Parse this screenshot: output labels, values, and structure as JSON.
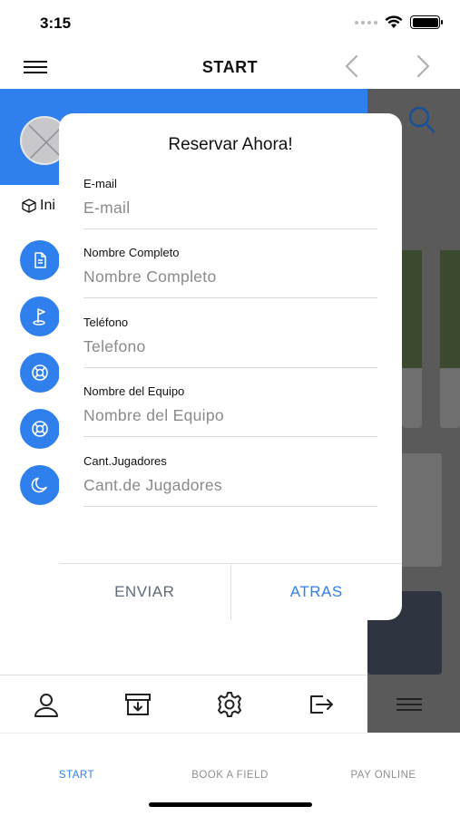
{
  "status_bar": {
    "time": "3:15"
  },
  "nav": {
    "title": "START"
  },
  "drawer": {
    "home_label": "Ini",
    "items": [
      {
        "icon": "document-icon"
      },
      {
        "icon": "golf-flag-icon"
      },
      {
        "icon": "lifebuoy-icon"
      },
      {
        "icon": "lifebuoy-icon"
      },
      {
        "icon": "moon-icon"
      }
    ],
    "footer": [
      "user-icon",
      "archive-download-icon",
      "gear-icon",
      "logout-icon"
    ]
  },
  "modal": {
    "title": "Reservar Ahora!",
    "fields": [
      {
        "label": "E-mail",
        "placeholder": "E-mail"
      },
      {
        "label": "Nombre Completo",
        "placeholder": "Nombre Completo"
      },
      {
        "label": "Teléfono",
        "placeholder": "Telefono"
      },
      {
        "label": "Nombre del Equipo",
        "placeholder": "Nombre del Equipo"
      },
      {
        "label": "Cant.Jugadores",
        "placeholder": "Cant.de Jugadores"
      }
    ],
    "submit_label": "ENVIAR",
    "back_label": "ATRAS"
  },
  "tabs": [
    {
      "label": "START"
    },
    {
      "label": "BOOK A FIELD"
    },
    {
      "label": "PAY ONLINE"
    }
  ],
  "colors": {
    "accent": "#2f80ed",
    "overlay": "#5a5a5a"
  }
}
